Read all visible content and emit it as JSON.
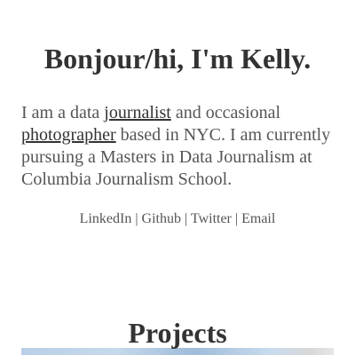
{
  "hero": {
    "title": "Bonjour/hi, I'm Kelly."
  },
  "intro": {
    "part1": "I am a data ",
    "link1": "journalist",
    "part2": " and occasional ",
    "link2": "photographer",
    "part3": " based in NYC. I am currently pursuing a Masters in Data Journalism at Columbia Journalism School."
  },
  "social": {
    "linkedin": "LinkedIn",
    "github": "Github",
    "twitter": "Twitter",
    "email": "Email",
    "separator": "|"
  },
  "projects": {
    "title": "Projects"
  }
}
